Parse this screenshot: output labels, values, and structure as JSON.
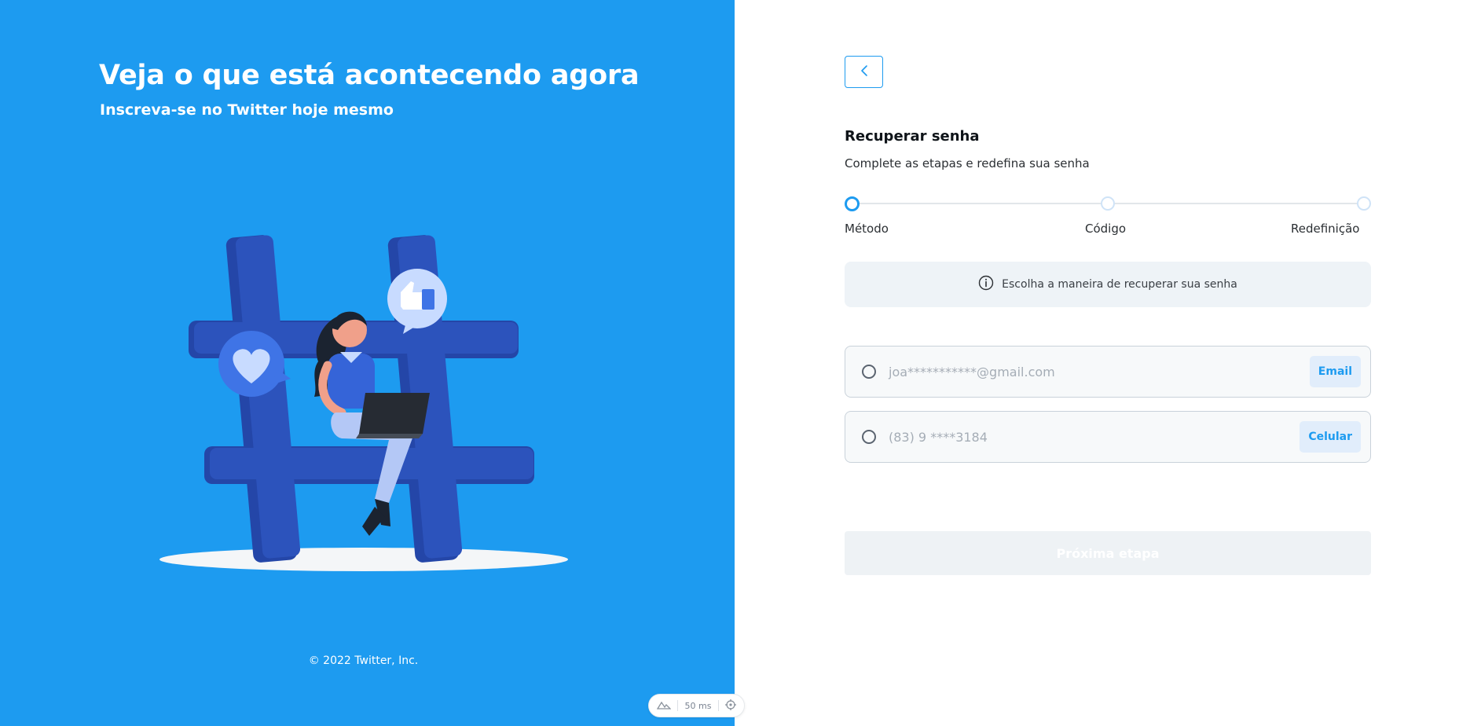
{
  "hero": {
    "headline": "Veja o que está acontecendo agora",
    "subheadline": "Inscreva-se no Twitter hoje mesmo",
    "copyright": "© 2022 Twitter, Inc."
  },
  "devbar": {
    "timing": "50 ms"
  },
  "form": {
    "title": "Recuperar senha",
    "subtitle": "Complete as etapas e redefina sua senha",
    "steps": [
      {
        "label": "Método",
        "state": "active"
      },
      {
        "label": "Código",
        "state": "pending"
      },
      {
        "label": "Redefinição",
        "state": "pending"
      }
    ],
    "info": "Escolha a maneira de recuperar sua senha",
    "options": [
      {
        "value": "joa***********@gmail.com",
        "tag": "Email"
      },
      {
        "value": "(83) 9 ****3184",
        "tag": "Celular"
      }
    ],
    "next_button": "Próxima etapa"
  },
  "colors": {
    "brand": "#1d9bf0",
    "hashtag": "#2c53bc",
    "text": "#0f1419"
  }
}
